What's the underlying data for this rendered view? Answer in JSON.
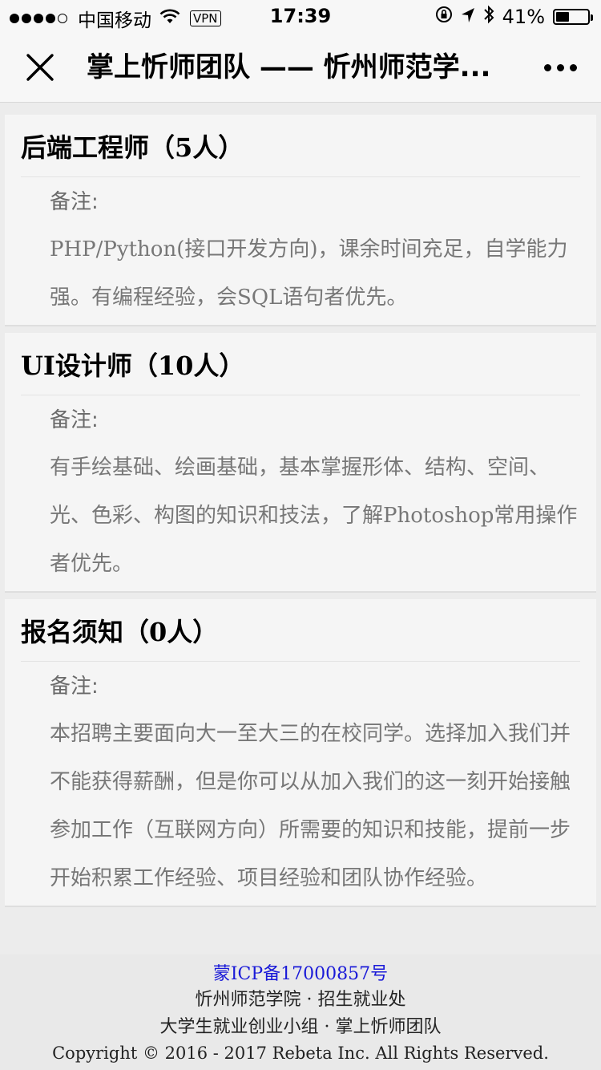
{
  "status_bar": {
    "carrier": "中国移动",
    "vpn": "VPN",
    "time": "17:39",
    "battery": "41%",
    "battery_level": 0.41
  },
  "navbar": {
    "title": "掌上忻师团队 —— 忻州师范学..."
  },
  "cards": [
    {
      "title": "后端工程师（5人）",
      "note_label": "备注:",
      "note_text": "PHP/Python(接口开发方向)，课余时间充足，自学能力强。有编程经验，会SQL语句者优先。"
    },
    {
      "title": "UI设计师（10人）",
      "note_label": "备注:",
      "note_text": "有手绘基础、绘画基础，基本掌握形体、结构、空间、光、色彩、构图的知识和技法，了解Photoshop常用操作者优先。"
    },
    {
      "title": "报名须知（0人）",
      "note_label": "备注:",
      "note_text": "本招聘主要面向大一至大三的在校同学。选择加入我们并不能获得薪酬，但是你可以从加入我们的这一刻开始接触参加工作（互联网方向）所需要的知识和技能，提前一步开始积累工作经验、项目经验和团队协作经验。"
    }
  ],
  "footer": {
    "icp": "蒙ICP备17000857号",
    "line1": "忻州师范学院 · 招生就业处",
    "line2": "大学生就业创业小组 · 掌上忻师团队",
    "copyright": "Copyright © 2016 - 2017 Rebeta Inc. All Rights Reserved."
  },
  "colors": {
    "icp_link": "#1a1ad8",
    "card_bg": "#f5f5f5",
    "note_text": "#777777"
  }
}
